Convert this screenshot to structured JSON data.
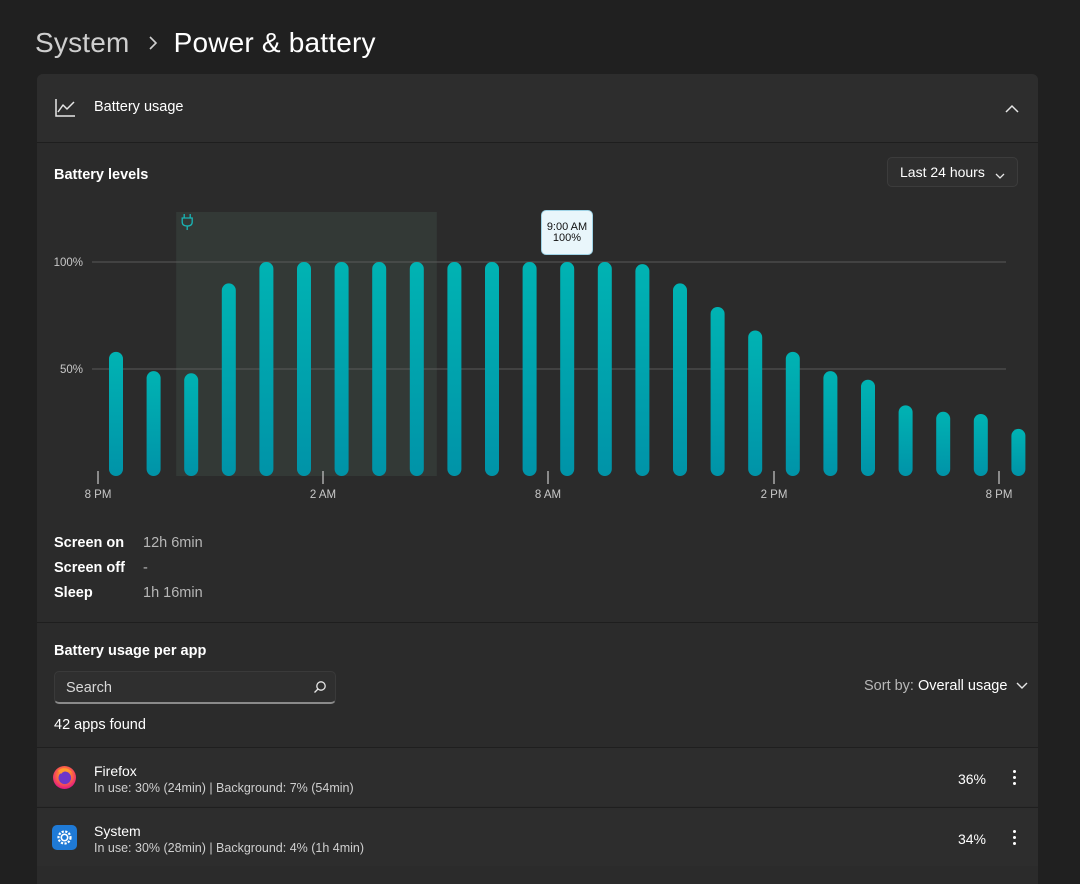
{
  "breadcrumb": {
    "parent": "System",
    "separator": "›",
    "current": "Power & battery"
  },
  "battery_usage": {
    "header_title": "Battery usage",
    "levels_title": "Battery levels",
    "range": "Last 24 hours",
    "tooltip": {
      "time": "9:00 AM",
      "value": "100%"
    }
  },
  "chart_data": {
    "type": "bar",
    "title": "Battery levels",
    "xlabel": "",
    "ylabel": "",
    "x_ticks": [
      "8 PM",
      "2 AM",
      "8 AM",
      "2 PM",
      "8 PM"
    ],
    "y_ticks": [
      "100%",
      "50%"
    ],
    "ylim": [
      0,
      100
    ],
    "categories": [
      "8 PM",
      "9 PM",
      "10 PM",
      "11 PM",
      "12 AM",
      "1 AM",
      "2 AM",
      "3 AM",
      "4 AM",
      "5 AM",
      "6 AM",
      "7 AM",
      "8 AM",
      "9 AM",
      "10 AM",
      "11 AM",
      "12 PM",
      "1 PM",
      "2 PM",
      "3 PM",
      "4 PM",
      "5 PM",
      "6 PM",
      "7 PM"
    ],
    "values": [
      58,
      49,
      48,
      90,
      100,
      100,
      100,
      100,
      100,
      100,
      100,
      100,
      100,
      100,
      99,
      90,
      79,
      68,
      58,
      49,
      45,
      33,
      30,
      29,
      22
    ],
    "charging_range": [
      "10 PM",
      "4 AM"
    ],
    "grid": true,
    "colors": {
      "bar": "#00b3b3",
      "bar_dark": "#0093a8",
      "charging_bg": "#333936",
      "grid": "#5a5a5a"
    }
  },
  "stats": [
    {
      "label": "Screen on",
      "value": "12h 6min"
    },
    {
      "label": "Screen off",
      "value": "-"
    },
    {
      "label": "Sleep",
      "value": "1h 16min"
    }
  ],
  "per_app": {
    "title": "Battery usage per app",
    "search_placeholder": "Search",
    "sort_label": "Sort by:",
    "sort_value": "Overall usage",
    "apps_found": "42 apps found",
    "apps": [
      {
        "name": "Firefox",
        "detail": "In use: 30% (24min) | Background: 7% (54min)",
        "percent": "36%",
        "icon": "firefox-icon"
      },
      {
        "name": "System",
        "detail": "In use: 30% (28min) | Background: 4% (1h 4min)",
        "percent": "34%",
        "icon": "system-gear-icon"
      }
    ]
  }
}
